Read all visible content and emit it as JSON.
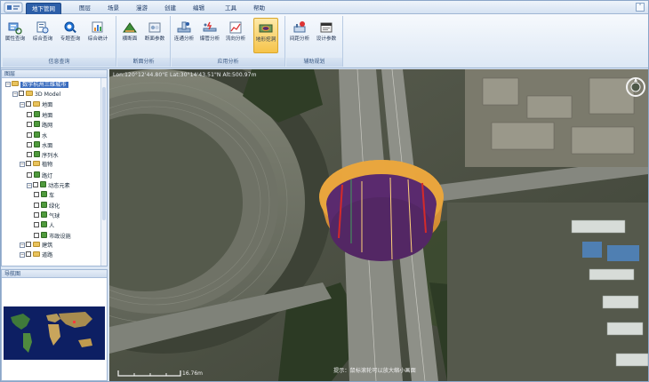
{
  "ribbon": {
    "tabs": [
      {
        "label": "地下管网",
        "active": true
      },
      {
        "label": "图层"
      },
      {
        "label": "场景"
      },
      {
        "label": "漫游"
      },
      {
        "label": "创建"
      },
      {
        "label": "编辑"
      },
      {
        "label": "工具"
      },
      {
        "label": "帮助"
      }
    ],
    "groups": [
      {
        "label": "信息查询",
        "buttons": [
          {
            "label": "属性查询",
            "icon": "pipe-query-icon"
          },
          {
            "label": "综合查询",
            "icon": "multi-query-icon"
          },
          {
            "label": "专题查询",
            "icon": "magnifier-icon"
          },
          {
            "label": "综合统计",
            "icon": "statistics-icon"
          }
        ]
      },
      {
        "label": "断面分析",
        "buttons": [
          {
            "label": "横断面",
            "icon": "cross-section-icon"
          },
          {
            "label": "断面参数",
            "icon": "section-params-icon"
          }
        ]
      },
      {
        "label": "应用分析",
        "buttons": [
          {
            "label": "连通分析",
            "icon": "connectivity-icon"
          },
          {
            "label": "爆管分析",
            "icon": "pipe-burst-icon"
          },
          {
            "label": "流向分析",
            "icon": "flow-direction-icon"
          },
          {
            "label": "地形挖洞",
            "icon": "terrain-excavation-icon",
            "active": true
          }
        ]
      },
      {
        "label": "辅助规划",
        "buttons": [
          {
            "label": "间距分析",
            "icon": "spacing-icon"
          },
          {
            "label": "设计参数",
            "icon": "design-params-icon"
          }
        ]
      }
    ]
  },
  "tree": {
    "title": "图层",
    "nodes": [
      {
        "label": "数字杭州三维城市",
        "level": 0,
        "selected": true
      },
      {
        "label": "3D Model",
        "level": 1
      },
      {
        "label": "地面",
        "level": 2
      },
      {
        "label": "地面",
        "level": 3
      },
      {
        "label": "路网",
        "level": 3
      },
      {
        "label": "水",
        "level": 3
      },
      {
        "label": "水面",
        "level": 3
      },
      {
        "label": "序列水",
        "level": 3
      },
      {
        "label": "植物",
        "level": 2
      },
      {
        "label": "路灯",
        "level": 3
      },
      {
        "label": "动态元素",
        "level": 3
      },
      {
        "label": "车",
        "level": 4
      },
      {
        "label": "绿化",
        "level": 4
      },
      {
        "label": "气球",
        "level": 4
      },
      {
        "label": "人",
        "level": 4
      },
      {
        "label": "市政设施",
        "level": 4
      },
      {
        "label": "建筑",
        "level": 2
      },
      {
        "label": "道路",
        "level": 2
      }
    ]
  },
  "overview": {
    "title": "导航图"
  },
  "viewport": {
    "coord_text": "Lon:120°12'44.80\"E  Lat:30°14'43.51\"N  Alt:500.97m",
    "tip": "提示：鼠标滚轮可以放大缩小画面",
    "scale_label": "16.76m"
  },
  "colors": {
    "accent": "#2d5fa8",
    "excavation_rim": "#f0a232",
    "excavation_floor": "#5a2a6e"
  }
}
